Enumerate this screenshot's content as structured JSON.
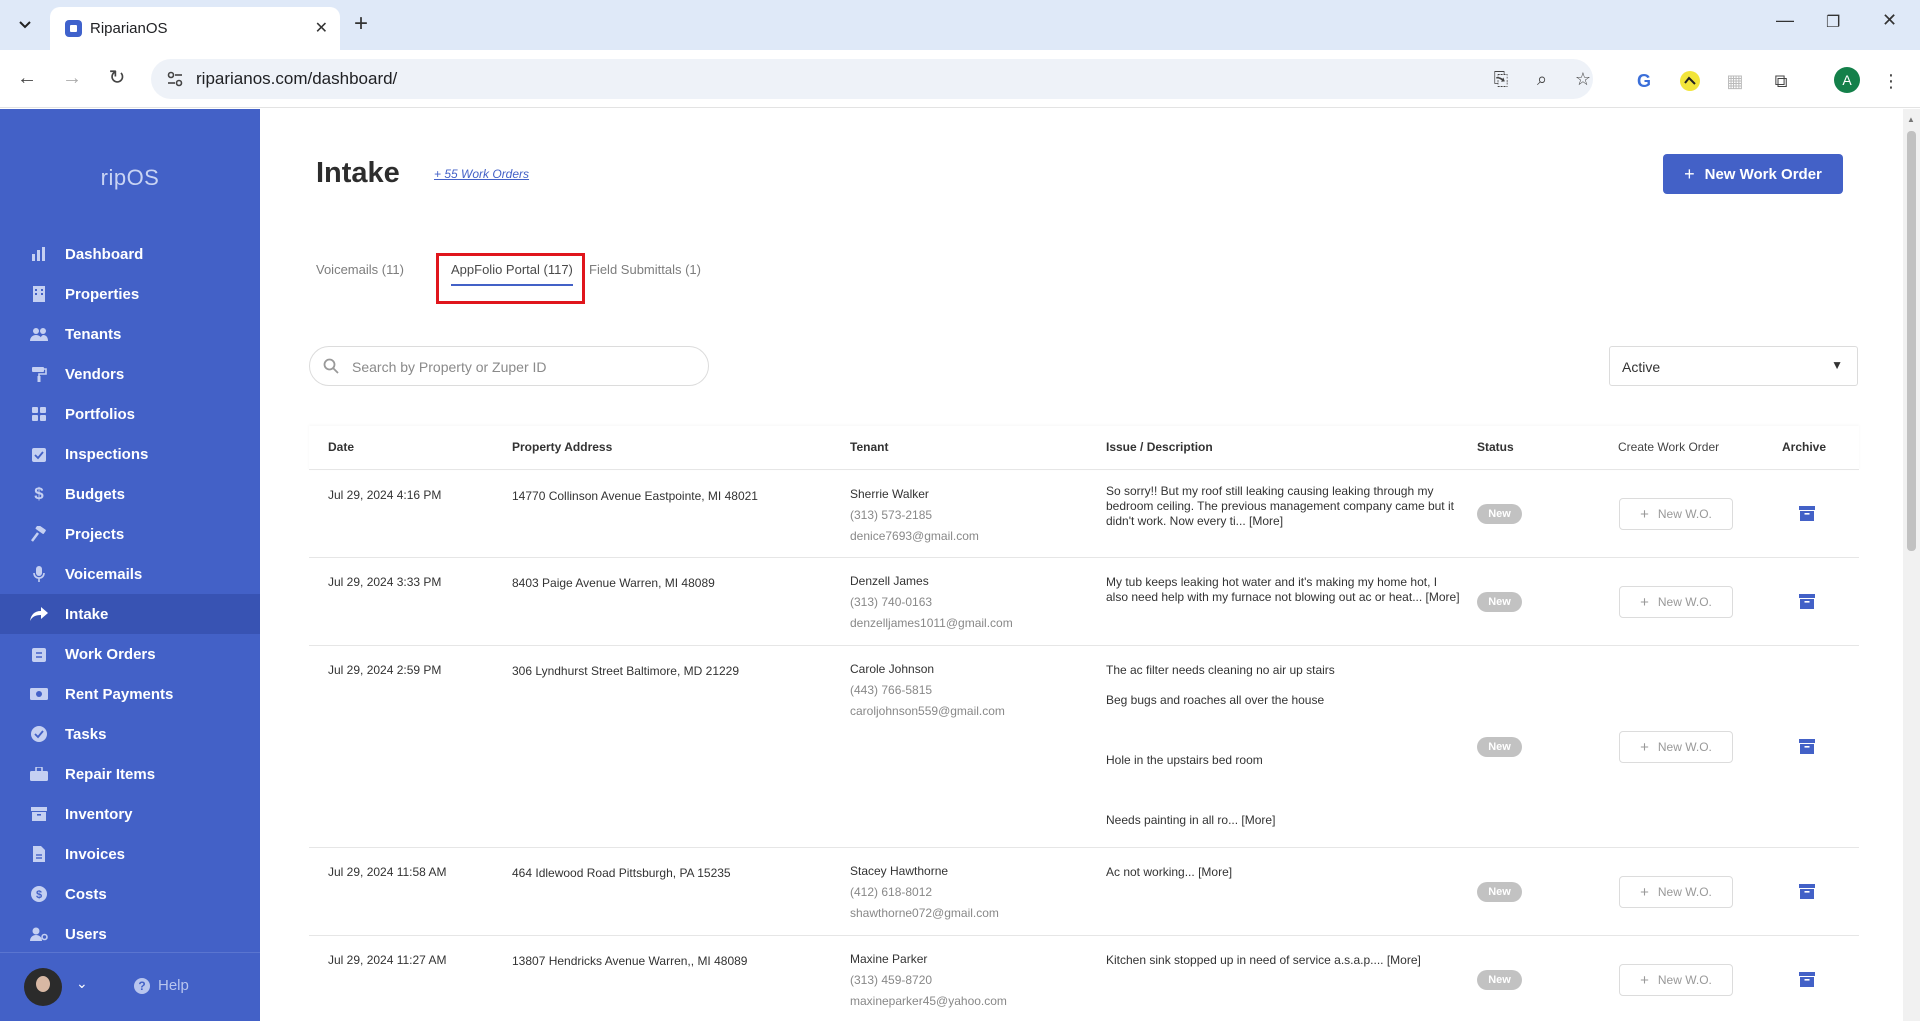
{
  "browser": {
    "tab_title": "RiparianOS",
    "url": "riparianos.com/dashboard/",
    "profile_initial": "A"
  },
  "sidebar": {
    "logo": "ripOS",
    "items": [
      {
        "label": "Dashboard",
        "icon": "bar-chart-icon"
      },
      {
        "label": "Properties",
        "icon": "building-icon"
      },
      {
        "label": "Tenants",
        "icon": "users-icon"
      },
      {
        "label": "Vendors",
        "icon": "paint-roller-icon"
      },
      {
        "label": "Portfolios",
        "icon": "grid-icon"
      },
      {
        "label": "Inspections",
        "icon": "clipboard-check-icon"
      },
      {
        "label": "Budgets",
        "icon": "dollar-icon"
      },
      {
        "label": "Projects",
        "icon": "hammer-icon"
      },
      {
        "label": "Voicemails",
        "icon": "microphone-icon"
      },
      {
        "label": "Intake",
        "icon": "share-arrow-icon",
        "active": true
      },
      {
        "label": "Work Orders",
        "icon": "clipboard-list-icon"
      },
      {
        "label": "Rent Payments",
        "icon": "money-bill-icon"
      },
      {
        "label": "Tasks",
        "icon": "check-circle-icon"
      },
      {
        "label": "Repair Items",
        "icon": "toolbox-icon"
      },
      {
        "label": "Inventory",
        "icon": "archive-icon"
      },
      {
        "label": "Invoices",
        "icon": "file-invoice-icon"
      },
      {
        "label": "Costs",
        "icon": "coin-icon"
      },
      {
        "label": "Users",
        "icon": "user-gear-icon"
      }
    ],
    "help_label": "Help"
  },
  "page": {
    "title": "Intake",
    "work_orders_link": "+ 55 Work Orders",
    "new_work_order_label": "New Work Order"
  },
  "tabs": [
    {
      "label": "Voicemails (11)"
    },
    {
      "label": "AppFolio Portal (117)",
      "active": true
    },
    {
      "label": "Field Submittals (1)"
    }
  ],
  "search": {
    "placeholder": "Search by Property or Zuper ID",
    "value": ""
  },
  "filter": {
    "selected": "Active"
  },
  "table": {
    "headers": {
      "date": "Date",
      "address": "Property Address",
      "tenant": "Tenant",
      "issue": "Issue / Description",
      "status": "Status",
      "create": "Create Work Order",
      "archive": "Archive"
    },
    "new_wo_label": "New W.O.",
    "more_label": "[More]",
    "rows": [
      {
        "date": "Jul 29, 2024 4:16 PM",
        "address": "14770 Collinson Avenue Eastpointe, MI 48021",
        "tenant_name": "Sherrie Walker",
        "tenant_phone": "(313) 573-2185",
        "tenant_email": "denice7693@gmail.com",
        "issue_lines": [
          "So sorry!! But my roof still leaking causing leaking through my bedroom ceiling. The previous management company came but it didn't work. Now every ti..."
        ],
        "status": "New"
      },
      {
        "date": "Jul 29, 2024 3:33 PM",
        "address": "8403 Paige Avenue Warren, MI 48089",
        "tenant_name": "Denzell James",
        "tenant_phone": "(313) 740-0163",
        "tenant_email": "denzelljames1011@gmail.com",
        "issue_lines": [
          "My tub keeps leaking hot water and it's making my home hot, I also need help with my furnace not blowing out ac or heat..."
        ],
        "status": "New"
      },
      {
        "date": "Jul 29, 2024 2:59 PM",
        "address": "306 Lyndhurst Street Baltimore, MD 21229",
        "tenant_name": "Carole Johnson",
        "tenant_phone": "(443) 766-5815",
        "tenant_email": "caroljohnson559@gmail.com",
        "issue_lines": [
          "The ac filter needs cleaning no air up stairs",
          "Beg bugs and roaches all over the house",
          "",
          "Hole in the upstairs bed room",
          "",
          "Needs painting in all ro..."
        ],
        "status": "New"
      },
      {
        "date": "Jul 29, 2024 11:58 AM",
        "address": "464 Idlewood Road Pittsburgh, PA 15235",
        "tenant_name": "Stacey Hawthorne",
        "tenant_phone": "(412) 618-8012",
        "tenant_email": "shawthorne072@gmail.com",
        "issue_lines": [
          "Ac not working..."
        ],
        "status": "New"
      },
      {
        "date": "Jul 29, 2024 11:27 AM",
        "address": "13807 Hendricks Avenue Warren,, MI 48089",
        "tenant_name": "Maxine Parker",
        "tenant_phone": "(313) 459-8720",
        "tenant_email": "maxineparker45@yahoo.com",
        "issue_lines": [
          "Kitchen sink stopped up in need of service a.s.a.p...."
        ],
        "status": "New"
      }
    ]
  },
  "colors": {
    "sidebar": "#4361c7",
    "accent": "#4361c7",
    "highlight": "#e0161c",
    "badge": "#c2c2c2"
  }
}
